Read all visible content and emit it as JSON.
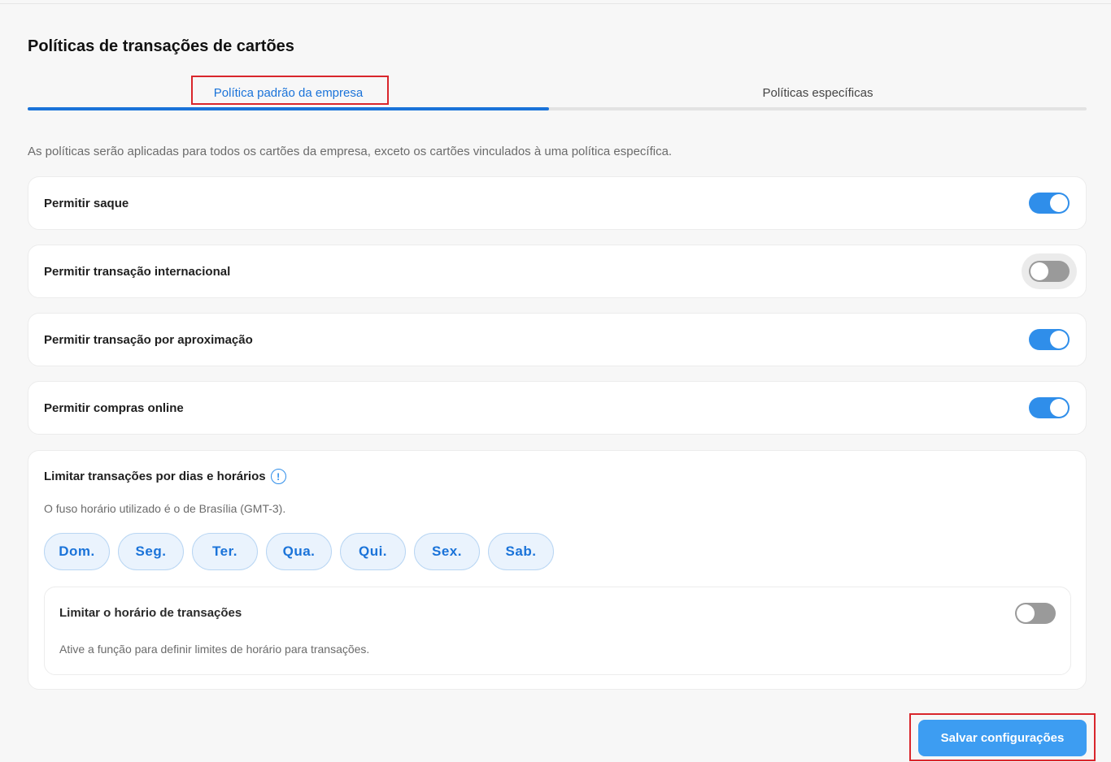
{
  "page": {
    "title": "Políticas de transações de cartões",
    "description": "As políticas serão aplicadas para todos os cartões da empresa, exceto os cartões vinculados à uma política específica."
  },
  "tabs": [
    {
      "label": "Política padrão da empresa",
      "active": true
    },
    {
      "label": "Políticas específicas",
      "active": false
    }
  ],
  "policies": [
    {
      "label": "Permitir saque",
      "enabled": true
    },
    {
      "label": "Permitir transação internacional",
      "enabled": false
    },
    {
      "label": "Permitir transação por aproximação",
      "enabled": true
    },
    {
      "label": "Permitir compras online",
      "enabled": true
    }
  ],
  "schedule": {
    "title": "Limitar transações por dias e horários",
    "info_icon": "!",
    "timezone_note": "O fuso horário utilizado é o de Brasília (GMT-3).",
    "days": [
      "Dom.",
      "Seg.",
      "Ter.",
      "Qua.",
      "Qui.",
      "Sex.",
      "Sab."
    ],
    "time_limit": {
      "title": "Limitar o horário de transações",
      "description": "Ative a função para definir limites de horário para transações.",
      "enabled": false
    }
  },
  "actions": {
    "save_label": "Salvar configurações"
  },
  "colors": {
    "accent": "#1a73d9",
    "toggle_on": "#2f8eea",
    "toggle_off": "#9a9a9a",
    "save_button": "#3d9df2",
    "highlight": "#d9262c"
  }
}
